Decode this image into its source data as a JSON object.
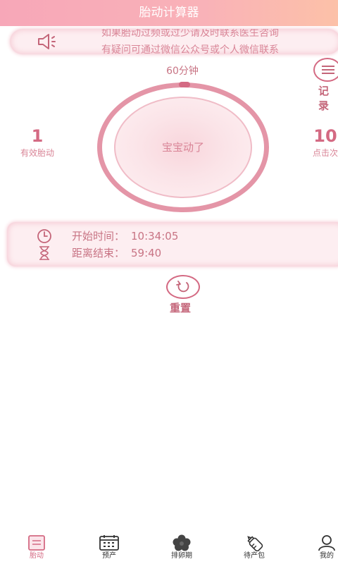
{
  "header": {
    "title": "胎动计算器"
  },
  "notice": {
    "line1": "如果胎动过频或过少请及时联系医生咨询",
    "line2": "有疑问可通过微信公众号或个人微信联系"
  },
  "timer": {
    "duration_label": "60分钟",
    "tap_label": "宝宝动了"
  },
  "stats": {
    "effective": {
      "value": "1",
      "label": "有效胎动"
    },
    "clicks": {
      "value": "10",
      "label": "点击次"
    }
  },
  "record": {
    "label": "记录"
  },
  "times": {
    "start_label": "开始时间：",
    "start_value": "10:34:05",
    "remain_label": "距离结束：",
    "remain_value": "59:40"
  },
  "reset": {
    "label": "重置"
  },
  "tabs": [
    {
      "label": "胎动",
      "icon": "clipboard-icon"
    },
    {
      "label": "预产",
      "icon": "calendar-icon"
    },
    {
      "label": "排卵期",
      "icon": "flower-icon"
    },
    {
      "label": "待产包",
      "icon": "baby-bottle-icon"
    },
    {
      "label": "我的",
      "icon": "user-icon"
    }
  ],
  "colors": {
    "accent": "#d46a83",
    "header_start": "#f7a7b8",
    "header_end": "#fcc1a8"
  }
}
